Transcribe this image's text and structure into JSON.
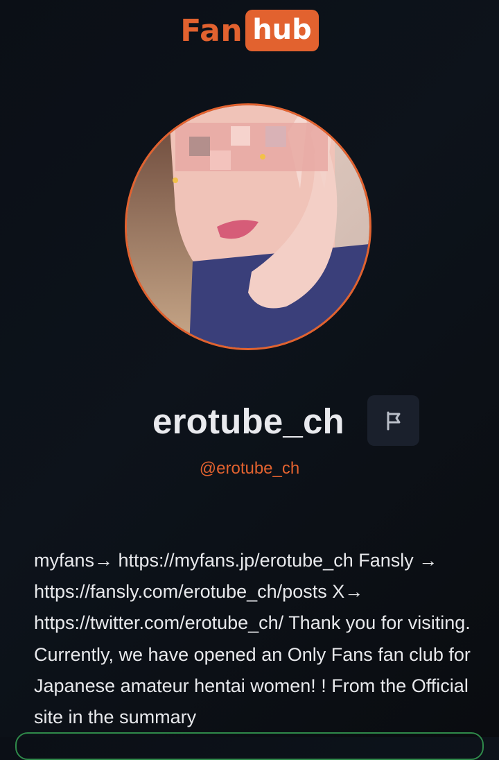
{
  "brand": {
    "part1": "Fan",
    "part2": "hub",
    "accent_color": "#e2622f"
  },
  "profile": {
    "avatar_icon": "profile-photo",
    "display_name": "erotube_ch",
    "handle": "@erotube_ch",
    "report_icon": "flag-icon",
    "bio": "myfans→ https://myfans.jp/erotube_ch Fansly → https://fansly.com/erotube_ch/posts X→ https://twitter.com/erotube_ch/ Thank you for visiting. Currently, we have opened an Only Fans fan club for Japanese amateur hentai women! ! From the Official site in the summary"
  },
  "colors": {
    "background": "#0b0f16",
    "handle_color": "#e2622f",
    "card_border": "#2f8a4a"
  }
}
